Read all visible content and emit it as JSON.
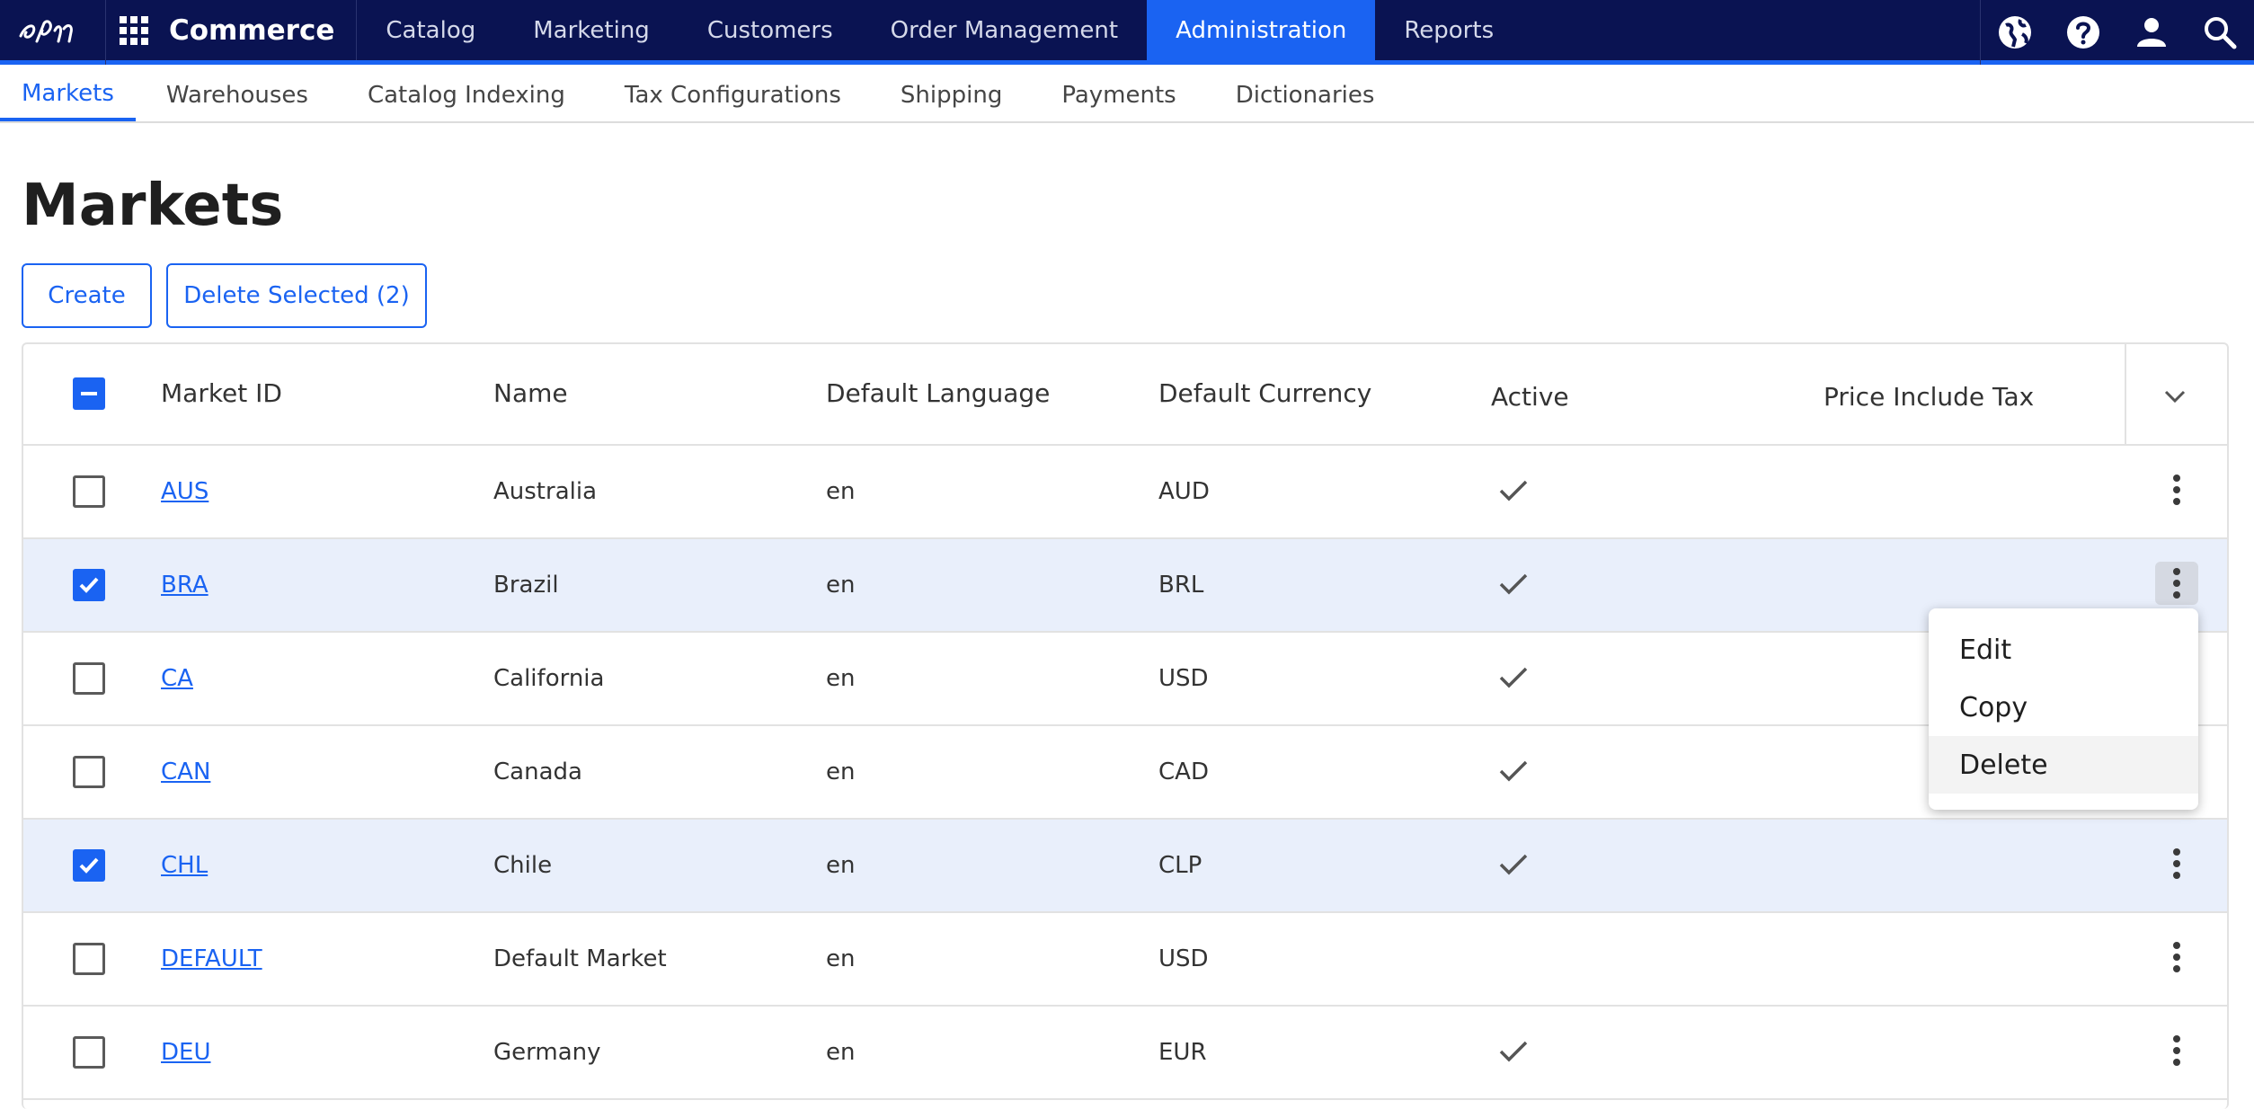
{
  "app": {
    "brand": "Commerce"
  },
  "top_nav": {
    "items": [
      {
        "label": "Catalog"
      },
      {
        "label": "Marketing"
      },
      {
        "label": "Customers"
      },
      {
        "label": "Order Management"
      },
      {
        "label": "Administration"
      },
      {
        "label": "Reports"
      }
    ],
    "active": "Administration",
    "icons": [
      "globe-icon",
      "help-icon",
      "user-icon",
      "search-icon"
    ]
  },
  "sub_nav": {
    "items": [
      {
        "label": "Markets"
      },
      {
        "label": "Warehouses"
      },
      {
        "label": "Catalog Indexing"
      },
      {
        "label": "Tax Configurations"
      },
      {
        "label": "Shipping"
      },
      {
        "label": "Payments"
      },
      {
        "label": "Dictionaries"
      }
    ],
    "active": "Markets"
  },
  "page": {
    "title": "Markets",
    "create_label": "Create",
    "delete_selected_label": "Delete Selected (2)"
  },
  "table": {
    "headers": {
      "market_id": "Market ID",
      "name": "Name",
      "language": "Default Language",
      "currency": "Default Currency",
      "active": "Active",
      "price_tax": "Price Include Tax"
    },
    "rows": [
      {
        "id": "AUS",
        "name": "Australia",
        "lang": "en",
        "currency": "AUD",
        "active": true,
        "selected": false
      },
      {
        "id": "BRA",
        "name": "Brazil",
        "lang": "en",
        "currency": "BRL",
        "active": true,
        "selected": true
      },
      {
        "id": "CA",
        "name": "California",
        "lang": "en",
        "currency": "USD",
        "active": true,
        "selected": false
      },
      {
        "id": "CAN",
        "name": "Canada",
        "lang": "en",
        "currency": "CAD",
        "active": true,
        "selected": false
      },
      {
        "id": "CHL",
        "name": "Chile",
        "lang": "en",
        "currency": "CLP",
        "active": true,
        "selected": true
      },
      {
        "id": "DEFAULT",
        "name": "Default Market",
        "lang": "en",
        "currency": "USD",
        "active": false,
        "selected": false
      },
      {
        "id": "DEU",
        "name": "Germany",
        "lang": "en",
        "currency": "EUR",
        "active": true,
        "selected": false
      }
    ]
  },
  "context_menu": {
    "items": [
      {
        "label": "Edit"
      },
      {
        "label": "Copy"
      },
      {
        "label": "Delete"
      }
    ],
    "highlighted": "Delete"
  },
  "colors": {
    "navy": "#0a1352",
    "accent": "#1a63f2",
    "selected_row": "#e9effb"
  }
}
